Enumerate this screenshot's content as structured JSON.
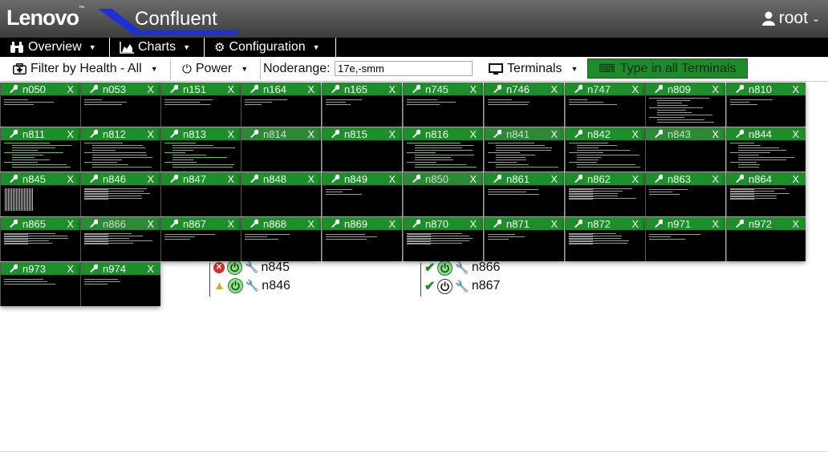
{
  "brand": {
    "logo": "Lenovo",
    "tm": "™",
    "app_title": "Confluent"
  },
  "user": {
    "name": "root"
  },
  "menu": [
    {
      "id": "overview",
      "label": "Overview",
      "icon": "binoculars-icon"
    },
    {
      "id": "charts",
      "label": "Charts",
      "icon": "area-chart-icon"
    },
    {
      "id": "configuration",
      "label": "Configuration",
      "icon": "gear-icon"
    }
  ],
  "toolbar": {
    "filter_label": "Filter by Health - All",
    "power_label": "Power",
    "noderange_label": "Noderange:",
    "noderange_value": "17e,-smm",
    "terminals_label": "Terminals",
    "type_all_label": "Type in all Terminals"
  },
  "node_list": [
    {
      "name": "n845",
      "health": "error",
      "power": "on"
    },
    {
      "name": "n846",
      "health": "warning",
      "power": "on"
    },
    {
      "name": "n866",
      "health": "ok",
      "power": "on"
    },
    {
      "name": "n867",
      "health": "ok",
      "power": "off"
    }
  ],
  "close_label": "X",
  "terminals": [
    {
      "name": "n050",
      "style": "sparse"
    },
    {
      "name": "n053",
      "style": "sparse"
    },
    {
      "name": "n151",
      "style": "sparse"
    },
    {
      "name": "n164",
      "style": "sparse"
    },
    {
      "name": "n165",
      "style": "sparse"
    },
    {
      "name": "n745",
      "style": "sparse"
    },
    {
      "name": "n746",
      "style": "sparse"
    },
    {
      "name": "n747",
      "style": "sparse"
    },
    {
      "name": "n809",
      "style": "dense"
    },
    {
      "name": "n810",
      "style": "sparse"
    },
    {
      "name": "n811",
      "style": "green"
    },
    {
      "name": "n812",
      "style": "dense"
    },
    {
      "name": "n813",
      "style": "green"
    },
    {
      "name": "n814",
      "style": "blank",
      "dim": true
    },
    {
      "name": "n815",
      "style": "blank"
    },
    {
      "name": "n816",
      "style": "green"
    },
    {
      "name": "n841",
      "style": "dense",
      "dim": true
    },
    {
      "name": "n842",
      "style": "dense"
    },
    {
      "name": "n843",
      "style": "blank",
      "dim": true
    },
    {
      "name": "n844",
      "style": "dense"
    },
    {
      "name": "n845",
      "style": "block"
    },
    {
      "name": "n846",
      "style": "table"
    },
    {
      "name": "n847",
      "style": "blank"
    },
    {
      "name": "n848",
      "style": "blank"
    },
    {
      "name": "n849",
      "style": "sparse"
    },
    {
      "name": "n850",
      "style": "blank",
      "dim": true
    },
    {
      "name": "n861",
      "style": "sparse"
    },
    {
      "name": "n862",
      "style": "table"
    },
    {
      "name": "n863",
      "style": "sparse"
    },
    {
      "name": "n864",
      "style": "table"
    },
    {
      "name": "n865",
      "style": "table"
    },
    {
      "name": "n866",
      "style": "table",
      "dim": true
    },
    {
      "name": "n867",
      "style": "sparse"
    },
    {
      "name": "n868",
      "style": "sparse"
    },
    {
      "name": "n869",
      "style": "sparse"
    },
    {
      "name": "n870",
      "style": "table"
    },
    {
      "name": "n871",
      "style": "sparse"
    },
    {
      "name": "n872",
      "style": "table"
    },
    {
      "name": "n971",
      "style": "sparse"
    },
    {
      "name": "n972",
      "style": "blank"
    },
    {
      "name": "n973",
      "style": "sparse"
    },
    {
      "name": "n974",
      "style": "sparse"
    }
  ]
}
